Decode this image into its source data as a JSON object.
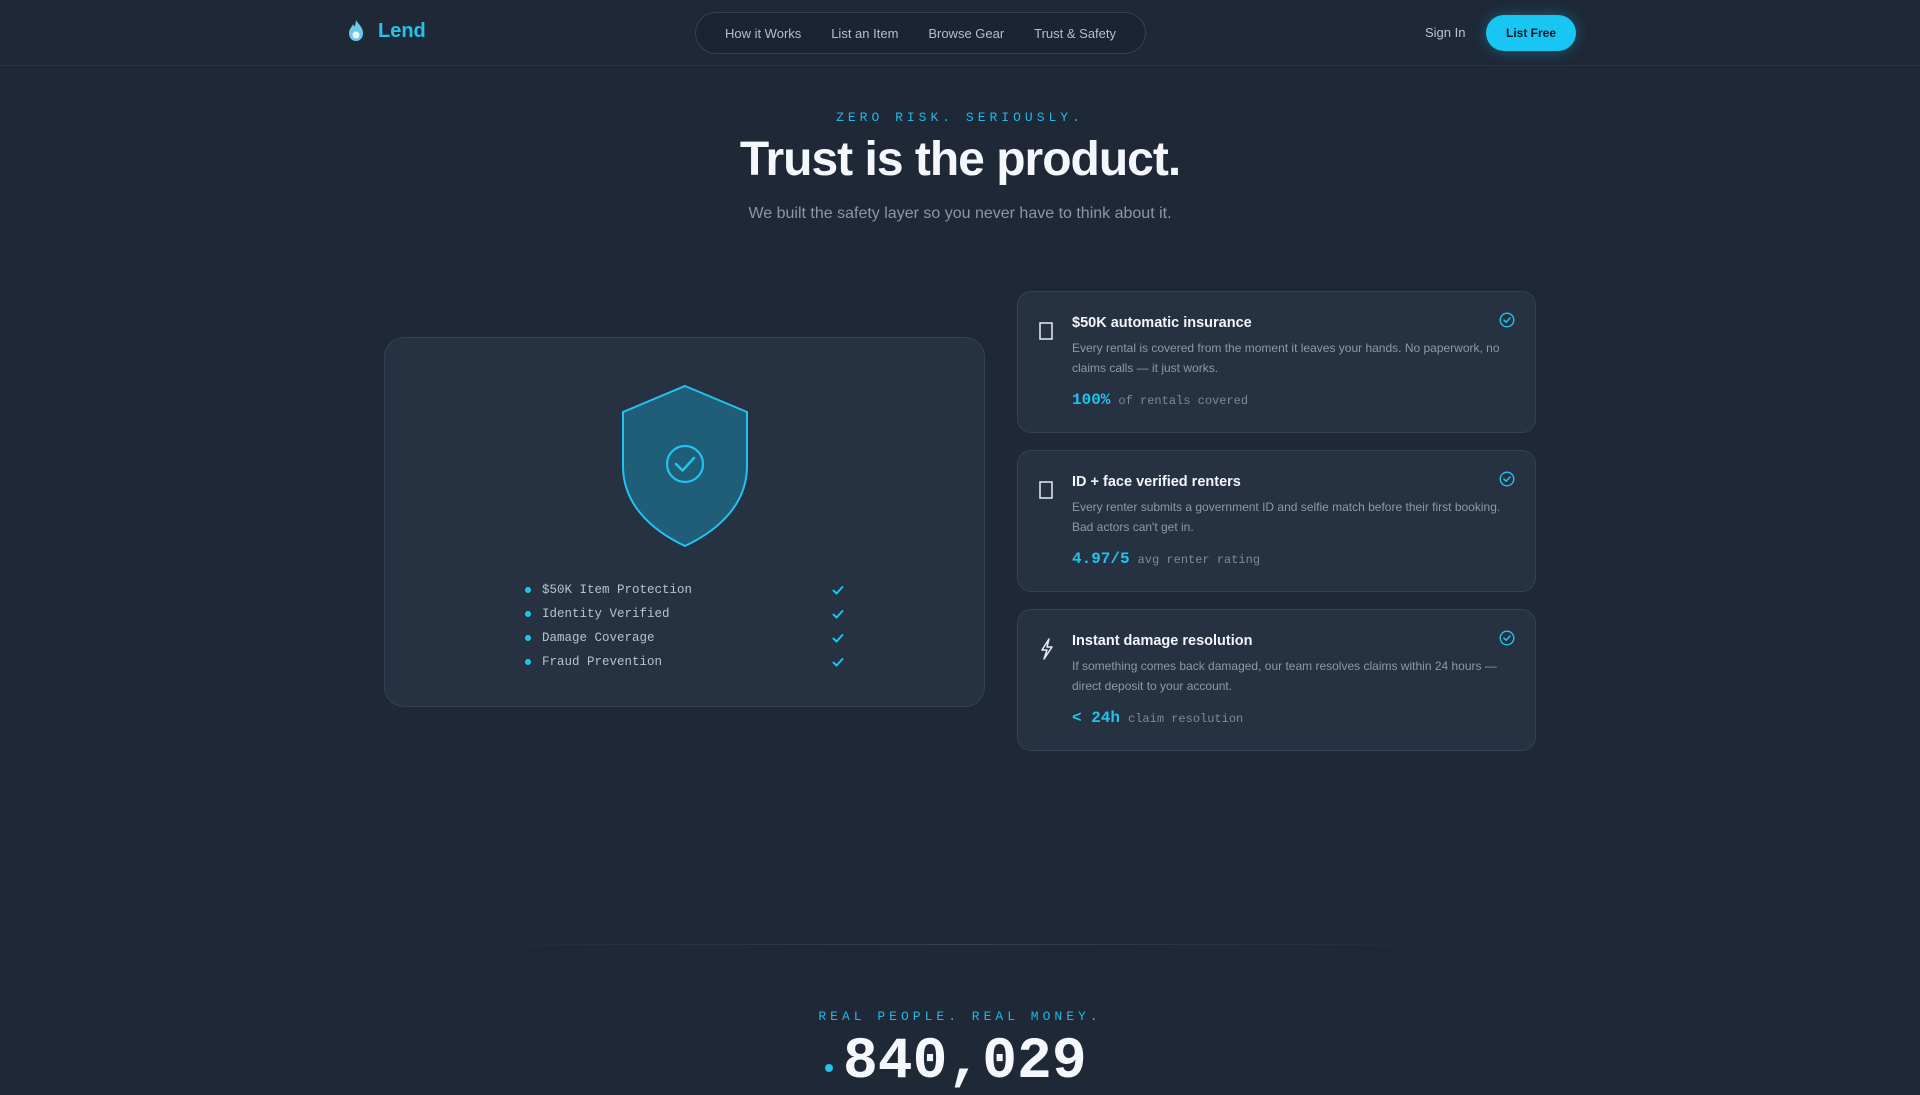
{
  "brand": {
    "name": "Lend"
  },
  "nav": {
    "items": [
      "How it Works",
      "List an Item",
      "Browse Gear",
      "Trust & Safety"
    ]
  },
  "header": {
    "signin_label": "Sign In",
    "cta_label": "List Free"
  },
  "hero": {
    "eyebrow": "ZERO RISK. SERIOUSLY.",
    "title": "Trust is the product.",
    "subtitle": "We built the safety layer so you never have to think about it."
  },
  "shield_card": {
    "checklist": [
      "$50K Item Protection",
      "Identity Verified",
      "Damage Coverage",
      "Fraud Prevention"
    ]
  },
  "features": [
    {
      "icon": "document-icon",
      "title": "$50K automatic insurance",
      "description": "Every rental is covered from the moment it leaves your hands. No paperwork, no claims calls — it just works.",
      "stat_value": "100%",
      "stat_label": "of rentals covered"
    },
    {
      "icon": "id-card-icon",
      "title": "ID + face verified renters",
      "description": "Every renter submits a government ID and selfie match before their first booking. Bad actors can't get in.",
      "stat_value": "4.97/5",
      "stat_label": "avg renter rating"
    },
    {
      "icon": "lightning-icon",
      "title": "Instant damage resolution",
      "description": "If something comes back damaged, our team resolves claims within 24 hours — direct deposit to your account.",
      "stat_value": "< 24h",
      "stat_label": "claim resolution"
    }
  ],
  "stats_section": {
    "eyebrow": "REAL PEOPLE. REAL MONEY.",
    "big_number": "840,029"
  },
  "colors": {
    "accent": "#22c3ef",
    "background": "#1e2837",
    "card": "#263142"
  }
}
